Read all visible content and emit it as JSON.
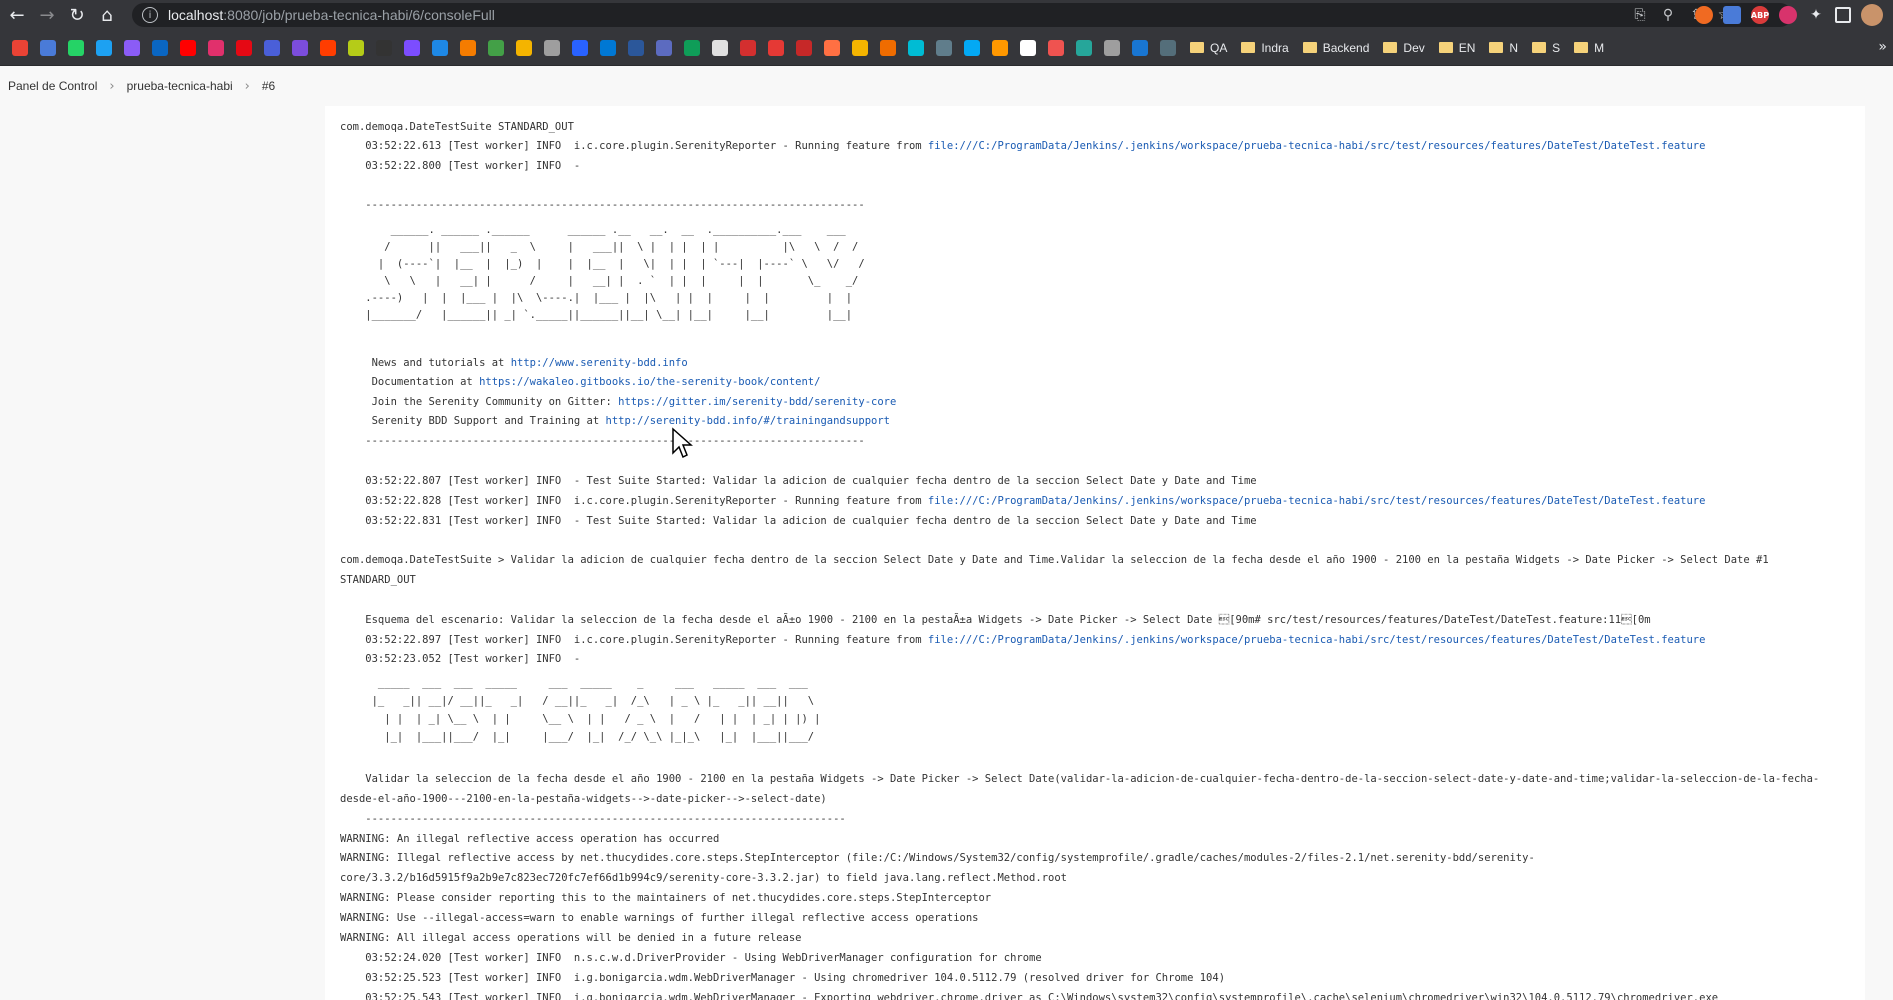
{
  "browser": {
    "url_host": "localhost",
    "url_rest": ":8080/job/prueba-tecnica-habi/6/consoleFull",
    "nav": {
      "back": "←",
      "forward": "→",
      "reload": "↻",
      "home": "⌂"
    },
    "omnibox_icons": [
      "translate-icon",
      "zoom-icon",
      "share-icon",
      "star-icon"
    ],
    "extensions": [
      {
        "name": "rss-ext",
        "color": "#f06a22",
        "label": ""
      },
      {
        "name": "translate-ext",
        "color": "#4a7bd8",
        "label": ""
      },
      {
        "name": "abp-ext",
        "color": "#d93b3b",
        "label": "ABP"
      },
      {
        "name": "pink-ext",
        "color": "#d8336c",
        "label": ""
      },
      {
        "name": "puzzle-ext",
        "color": "#5f6368",
        "label": ""
      },
      {
        "name": "sidebar-ext",
        "color": "#5f6368",
        "label": ""
      },
      {
        "name": "profile-avatar",
        "color": "#c9936a",
        "label": ""
      }
    ]
  },
  "bookmarks": {
    "icon_colors": [
      "#ea4335",
      "#4a7bd8",
      "#25d366",
      "#1da1f2",
      "#8b5cf6",
      "#0a66c2",
      "#ff0000",
      "#e1306c",
      "#e50914",
      "#4a5fd8",
      "#7c4ddc",
      "#ff3d00",
      "#b5cc18",
      "#333333",
      "#7c4dff",
      "#1e88e5",
      "#f57c00",
      "#43a047",
      "#f4b400",
      "#9e9e9e",
      "#2962ff",
      "#0078d4",
      "#2b579a",
      "#5c6bc0",
      "#0f9d58",
      "#e0e0e0",
      "#d32f2f",
      "#e53935",
      "#c62828",
      "#ff7043",
      "#f4b400",
      "#ef6c00",
      "#00bcd4",
      "#607d8b",
      "#03a9f4",
      "#ff9800",
      "#ffffff",
      "#ef5350",
      "#26a69a",
      "#9e9e9e",
      "#1976d2",
      "#546e7a"
    ],
    "folders": [
      "QA",
      "Indra",
      "Backend",
      "Dev",
      "EN",
      "N",
      "S",
      "M"
    ],
    "more": "»"
  },
  "breadcrumb": {
    "items": [
      "Panel de Control",
      "prueba-tecnica-habi",
      "#6"
    ],
    "separator": "›"
  },
  "console": {
    "lines": [
      "com.demoqa.DateTestSuite STANDARD_OUT",
      "    03:52:22.613 [Test worker] INFO  i.c.core.plugin.SerenityReporter - Running feature from ",
      "    03:52:22.800 [Test worker] INFO  -",
      "    -------------------------------------------------------------------------------",
      "        ______. ______ .______      ______ .__   __.  __  .__________.___    ___",
      "       /      ||   ___||   _  \\     |   ___||  \\ |  | |  | |          |\\   \\  /  /",
      "      |  (----`|  |__  |  |_)  |    |  |__  |   \\|  | |  | `---|  |----` \\   \\/   /",
      "       \\   \\   |   __| |      /     |   __| |  . `  | |  |     |  |       \\_    _/",
      "    .----)   |  |  |___ |  |\\  \\----.|  |___ |  |\\   | |  |     |  |         |  |",
      "    |_______/   |______|| _| `._____||______||__| \\__| |__|     |__|         |__|",
      "     News and tutorials at ",
      "     Documentation at ",
      "     Join the Serenity Community on Gitter: ",
      "     Serenity BDD Support and Training at ",
      "    -------------------------------------------------------------------------------",
      "    03:52:22.807 [Test worker] INFO  - Test Suite Started: Validar la adicion de cualquier fecha dentro de la seccion Select Date y Date and Time",
      "    03:52:22.828 [Test worker] INFO  i.c.core.plugin.SerenityReporter - Running feature from ",
      "    03:52:22.831 [Test worker] INFO  - Test Suite Started: Validar la adicion de cualquier fecha dentro de la seccion Select Date y Date and Time",
      "com.demoqa.DateTestSuite > Validar la adicion de cualquier fecha dentro de la seccion Select Date y Date and Time.Validar la seleccion de la fecha desde el año 1900 - 2100 en la pestaña Widgets -> Date Picker -> Select Date #1",
      "STANDARD_OUT",
      "    Esquema del escenario: Validar la seleccion de la fecha desde el aÃ±o 1900 - 2100 en la pestaÃ±a Widgets -> Date Picker -> Select Date \u001b[90m# src/test/resources/features/DateTest/DateTest.feature:11\u001b[0m",
      "    03:52:22.897 [Test worker] INFO  i.c.core.plugin.SerenityReporter - Running feature from ",
      "    03:52:23.052 [Test worker] INFO  -",
      "      _____  ___  ___  _____     ___  _____    _     ___   _____  ___  ___",
      "     |_   _|| __|/ __||_   _|   / __||_   _|  /_\\   | _ \\ |_   _|| __||   \\",
      "       | |  | _| \\__ \\  | |     \\__ \\  | |   / _ \\  |   /   | |  | _| | |) |",
      "       |_|  |___||___/  |_|     |___/  |_|  /_/ \\_\\ |_|_\\   |_|  |___||___/",
      "    Validar la seleccion de la fecha desde el año 1900 - 2100 en la pestaña Widgets -> Date Picker -> Select Date(validar-la-adicion-de-cualquier-fecha-dentro-de-la-seccion-select-date-y-date-and-time;validar-la-seleccion-de-la-fecha-",
      "desde-el-año-1900---2100-en-la-pestaña-widgets-->-date-picker-->-select-date)",
      "    ----------------------------------------------------------------------------",
      "WARNING: An illegal reflective access operation has occurred",
      "WARNING: Illegal reflective access by net.thucydides.core.steps.StepInterceptor (file:/C:/Windows/System32/config/systemprofile/.gradle/caches/modules-2/files-2.1/net.serenity-bdd/serenity-",
      "core/3.3.2/b16d5915f9a2b9e7c823ec720fc7ef66d1b994c9/serenity-core-3.3.2.jar) to field java.lang.reflect.Method.root",
      "WARNING: Please consider reporting this to the maintainers of net.thucydides.core.steps.StepInterceptor",
      "WARNING: Use --illegal-access=warn to enable warnings of further illegal reflective access operations",
      "WARNING: All illegal access operations will be denied in a future release",
      "    03:52:24.020 [Test worker] INFO  n.s.c.w.d.DriverProvider - Using WebDriverManager configuration for chrome",
      "    03:52:25.523 [Test worker] INFO  i.g.bonigarcia.wdm.WebDriverManager - Using chromedriver 104.0.5112.79 (resolved driver for Chrome 104)",
      "    03:52:25.543 [Test worker] INFO  i.g.bonigarcia.wdm.WebDriverManager - Exporting webdriver.chrome.driver as C:\\Windows\\system32\\config\\systemprofile\\.cache\\selenium\\chromedriver\\win32\\104.0.5112.79\\chromedriver.exe"
    ],
    "links": {
      "feature_path": "file:///C:/ProgramData/Jenkins/.jenkins/workspace/prueba-tecnica-habi/src/test/resources/features/DateTest/DateTest.feature",
      "serenity_url": "http://www.serenity-bdd.info",
      "docs_url": "https://wakaleo.gitbooks.io/the-serenity-book/content/",
      "gitter_url": "https://gitter.im/serenity-bdd/serenity-core",
      "training_url": "http://serenity-bdd.info/#/trainingandsupport"
    }
  }
}
